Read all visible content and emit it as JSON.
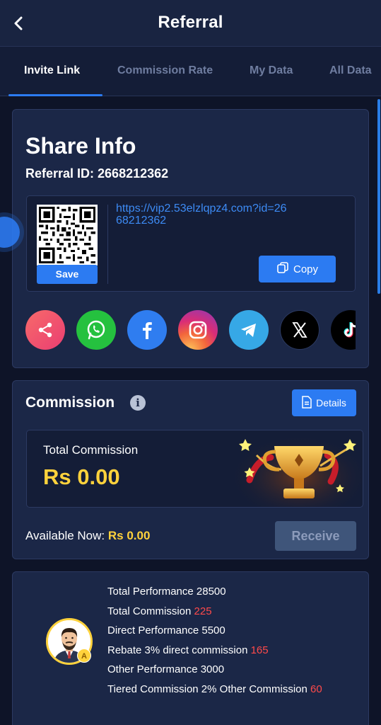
{
  "header": {
    "title": "Referral",
    "back_icon": "chevron-left-icon"
  },
  "tabs": [
    {
      "label": "Invite Link",
      "active": true
    },
    {
      "label": "Commission Rate",
      "active": false
    },
    {
      "label": "My Data",
      "active": false
    },
    {
      "label": "All Data",
      "active": false
    }
  ],
  "share": {
    "title": "Share Info",
    "referral_id": "Referral ID: 2668212362",
    "link": "https://vip2.53elzlqpz4.com?id=2668212362",
    "save_label": "Save",
    "copy_label": "Copy",
    "socials": [
      {
        "name": "share",
        "color": "#f2536a"
      },
      {
        "name": "whatsapp",
        "color": "#25c13f"
      },
      {
        "name": "facebook",
        "color": "#2f7df0"
      },
      {
        "name": "instagram",
        "color": "#e1306c"
      },
      {
        "name": "telegram",
        "color": "#36a8e6"
      },
      {
        "name": "x",
        "color": "#000000"
      },
      {
        "name": "tiktok",
        "color": "#000000"
      }
    ]
  },
  "commission": {
    "title": "Commission",
    "details_label": "Details",
    "total_label": "Total Commission",
    "total_value": "Rs 0.00",
    "available_label": "Available Now: ",
    "available_value": "Rs 0.00",
    "receive_label": "Receive"
  },
  "performance": {
    "badge": "A",
    "rows": [
      {
        "label": "Total Performance 28500",
        "value": ""
      },
      {
        "label": "Total Commission ",
        "value": "225"
      },
      {
        "label": "Direct Performance 5500",
        "value": ""
      },
      {
        "label": "Rebate 3% direct commission ",
        "value": "165"
      },
      {
        "label": "Other Performance 3000",
        "value": ""
      },
      {
        "label": "Tiered Commission 2% Other Commission ",
        "value": "60"
      }
    ]
  },
  "colors": {
    "accent": "#2c7bf2",
    "gold": "#ffd23c",
    "highlight": "#ff4a4a",
    "background": "#0e1428",
    "card": "#1b2747"
  }
}
